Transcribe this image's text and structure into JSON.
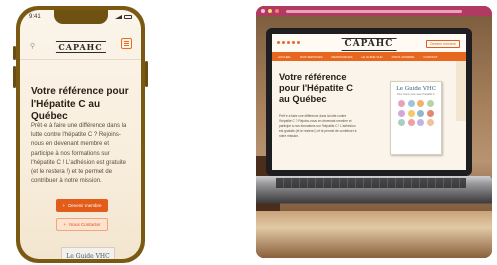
{
  "phone": {
    "status": {
      "time": "9:41"
    },
    "logo": "CAPAHC",
    "search_icon": "magnifier-icon",
    "menu_icon": "hamburger-icon",
    "hero": {
      "title": "Votre référence pour l'Hépatite C au Québec",
      "body": "Prêt·e à faire une différence dans la lutte contre l'hépatite C ? Rejoins-nous en devenant membre et participe à nos formations sur l'hépatite C ! L'adhésion est gratuite (et le restera !) et te permet de contribuer à notre mission."
    },
    "buttons": {
      "primary": "Devenir membre",
      "secondary": "Nous Contacter"
    },
    "guide_peek": "Le Guide VHC"
  },
  "laptop": {
    "logo": "CAPAHC",
    "join_button": "Devenir membre",
    "nav": [
      "ACCUEIL",
      "NOS SERVICES",
      "RESSOURCES",
      "LE GUIDE VHC",
      "NOUS JOINDRE",
      "CONTACT"
    ],
    "hero": {
      "title": "Votre référence pour l'Hépatite C au Québec",
      "body": "Prêt·e à faire une différence dans la lutte contre l'hépatite C ? Rejoins-nous en devenant membre et participe à nos formations sur l'hépatite C ! L'adhésion est gratuite (et le restera !) et te permet de contribuer à notre mission."
    },
    "book": {
      "title": "Le Guide VHC",
      "subtitle": "Pour mieux vivre avec l'hépatite C",
      "icon_colors": [
        "#e9a3b8",
        "#9ec5d6",
        "#f0b26b",
        "#b6d4a5",
        "#d7a6d9",
        "#f3c969",
        "#8fb8cf",
        "#e8866e",
        "#a9cfc4",
        "#f0a0a0",
        "#c1b3e6",
        "#f2c39a"
      ]
    }
  },
  "colors": {
    "accent": "#e35d1a",
    "browser_bar": "#b13a63",
    "phone_frame": "#7a5a12"
  }
}
